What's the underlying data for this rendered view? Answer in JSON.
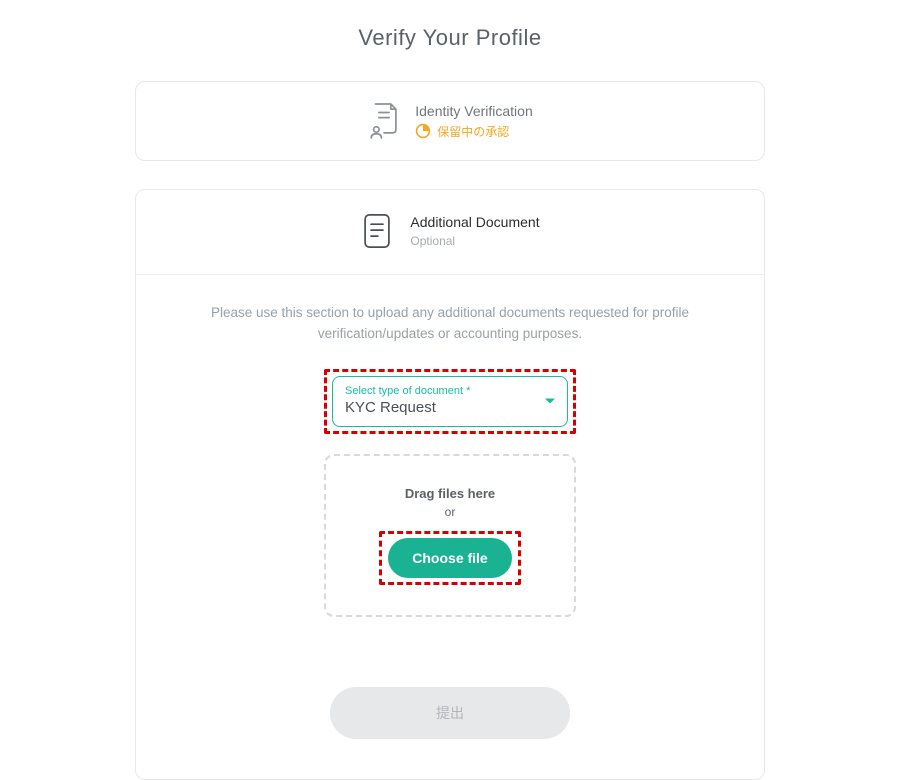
{
  "page": {
    "title": "Verify Your Profile"
  },
  "identity": {
    "title": "Identity Verification",
    "status_label": "保留中の承認"
  },
  "document": {
    "title": "Additional Document",
    "subtitle": "Optional",
    "instruction": "Please use this section to upload any additional documents requested for profile verification/updates or accounting purposes.",
    "select_label": "Select type of document *",
    "select_value": "KYC Request",
    "drag_text": "Drag files here",
    "or_text": "or",
    "choose_label": "Choose file",
    "submit_label": "提出"
  }
}
